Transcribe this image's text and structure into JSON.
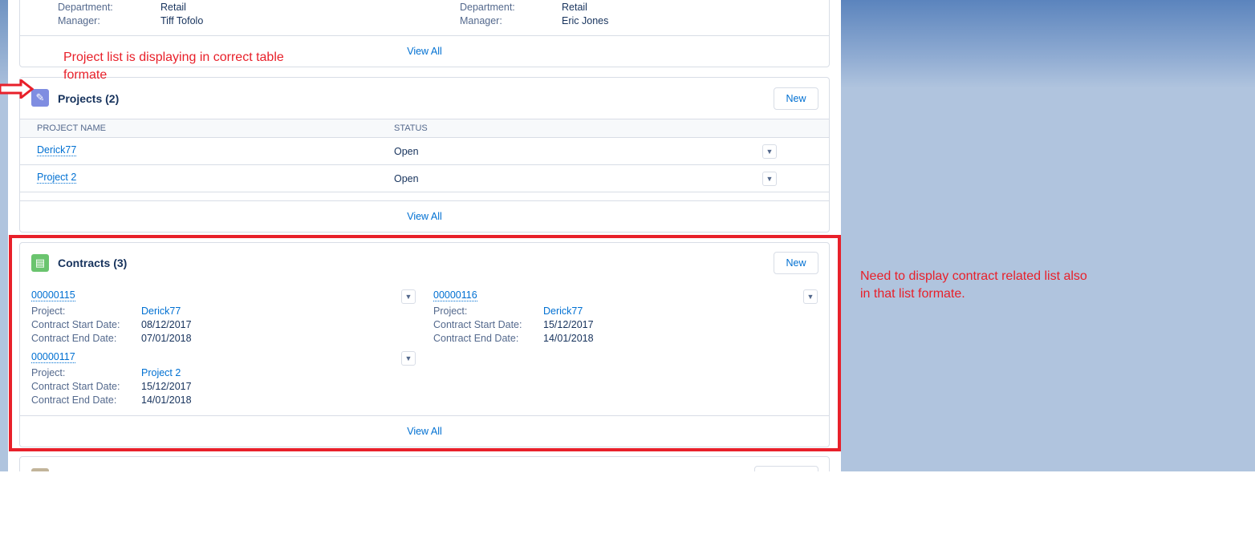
{
  "top_card": {
    "left": {
      "department_label": "Department:",
      "department": "Retail",
      "manager_label": "Manager:",
      "manager": "Tiff Tofolo"
    },
    "right": {
      "department_label": "Department:",
      "department": "Retail",
      "manager_label": "Manager:",
      "manager": "Eric Jones"
    },
    "view_all": "View All"
  },
  "projects": {
    "title": "Projects (2)",
    "new_label": "New",
    "columns": [
      "PROJECT NAME",
      "STATUS"
    ],
    "rows": [
      {
        "name": "Derick77",
        "status": "Open"
      },
      {
        "name": "Project 2",
        "status": "Open"
      }
    ],
    "view_all": "View All"
  },
  "contracts": {
    "title": "Contracts (3)",
    "new_label": "New",
    "labels": {
      "project": "Project:",
      "start": "Contract Start Date:",
      "end": "Contract End Date:"
    },
    "items": [
      {
        "number": "00000115",
        "project": "Derick77",
        "start": "08/12/2017",
        "end": "07/01/2018"
      },
      {
        "number": "00000116",
        "project": "Derick77",
        "start": "15/12/2017",
        "end": "14/01/2018"
      },
      {
        "number": "00000117",
        "project": "Project 2",
        "start": "15/12/2017",
        "end": "14/01/2018"
      }
    ],
    "view_all": "View All"
  },
  "annotations": {
    "projects_note": "Project list is displaying in correct table formate",
    "contracts_note": "Need to display contract related list also in that list formate."
  },
  "colors": {
    "accent": "#0070d2",
    "annotation": "#e8202a",
    "projects_icon": "#7f8de1",
    "contracts_icon": "#6ac46e"
  }
}
